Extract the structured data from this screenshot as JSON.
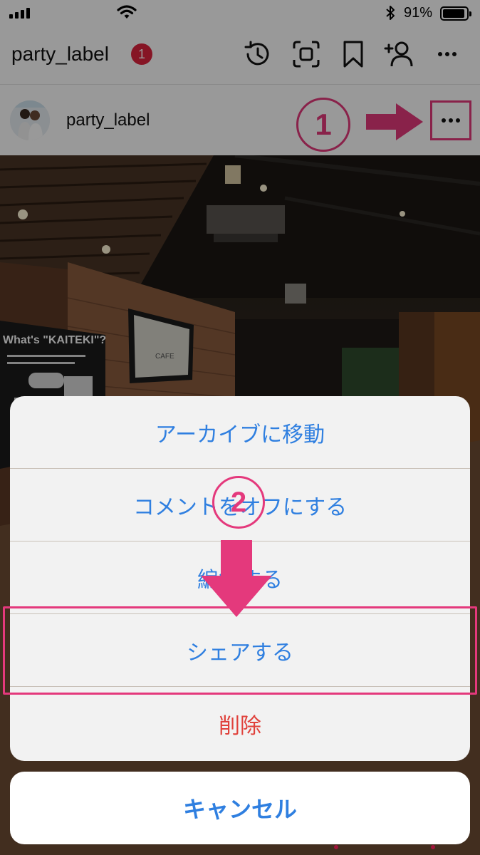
{
  "status_bar": {
    "time": "",
    "battery_percent": "91%"
  },
  "header": {
    "username": "party_label",
    "notification_count": "1"
  },
  "post": {
    "username": "party_label",
    "photo_signs": {
      "kaiteki_board": "What's \"KAITEKI\"?",
      "cafe_sign": "CAFE"
    }
  },
  "annotations": {
    "step1": "1",
    "step2": "2",
    "accent_color": "#e4397c"
  },
  "action_sheet": {
    "items": [
      "アーカイブに移動",
      "コメントをオフにする",
      "編集する",
      "シェアする",
      "削除"
    ],
    "cancel": "キャンセル"
  },
  "colors": {
    "ios_blue": "#2f7fe0",
    "destructive_red": "#e0413b",
    "badge_red": "#e0243f"
  }
}
